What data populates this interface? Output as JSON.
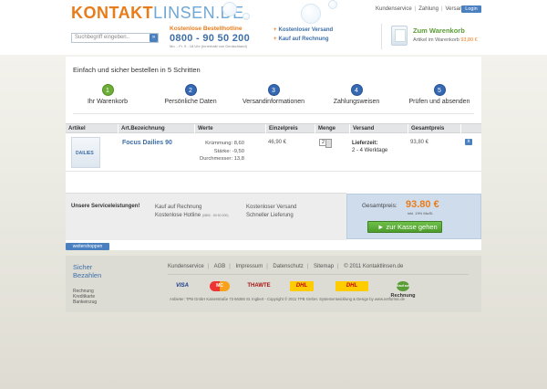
{
  "header": {
    "logo_part1": "KONTAKT",
    "logo_part2": "LINSEN.DE",
    "search_placeholder": "Suchbegriff eingeben..",
    "search_go": "»",
    "hotline_title": "Kostenlose Bestellhotline",
    "hotline_number": "0800 - 90 50 200",
    "hotline_hours": "Mo. - Fr. 9 - 18 Uhr (innerhalb von Deutschland)",
    "features": [
      "Kostenloser Versand",
      "Kauf auf Rechnung"
    ],
    "top_links": [
      "Kundenservice",
      "Zahlung",
      "Versand"
    ],
    "login": "Login",
    "cart_title": "Zum Warenkorb",
    "cart_label": "Artikel im Warenkorb",
    "cart_amount": "93,80 €"
  },
  "steps": {
    "title": "Einfach und sicher bestellen in 5 Schritten",
    "items": [
      {
        "num": "1",
        "label": "Ihr Warenkorb"
      },
      {
        "num": "2",
        "label": "Persönliche Daten"
      },
      {
        "num": "3",
        "label": "Versandinformationen"
      },
      {
        "num": "4",
        "label": "Zahlungsweisen"
      },
      {
        "num": "5",
        "label": "Prüfen und absenden"
      }
    ]
  },
  "table": {
    "headers": [
      "Artikel",
      "Art.Bezeichnung",
      "Werte",
      "Einzelpreis",
      "Menge",
      "Versand",
      "Gesamtpreis"
    ],
    "row": {
      "image_text": "DAILIES",
      "name": "Focus Dailies 90",
      "werte": [
        "Krümmung: 8,60",
        "Stärke: -9,50",
        "Durchmesser: 13,8"
      ],
      "einzelpreis": "46,90 €",
      "menge": "2",
      "versand_label": "Lieferzeit:",
      "versand_value": "2 - 4 Werktage",
      "gesamtpreis": "93,80 €",
      "delete": "x"
    }
  },
  "service": {
    "title": "Unsere Serviceleistungen!",
    "col1": [
      "Kauf auf Rechnung",
      "Kostenlose Hotline"
    ],
    "col1_small": "(0800 - 90 50 200)",
    "col2": [
      "Kostenloser Versand",
      "Schneller Lieferung"
    ]
  },
  "total": {
    "label": "Gesamtpreis:",
    "value": "93.80 €",
    "note": "inkl. 19% MwSt.",
    "checkout": "zur Kasse gehen"
  },
  "weiter": "weitershoppen",
  "footer": {
    "sicher": [
      "Sicher",
      "Bezahlen"
    ],
    "methods_text": [
      "Rechnung",
      "Kreditkarte",
      "Bankeinzug"
    ],
    "links": [
      "Kundenservice",
      "AGB",
      "Impressum",
      "Datenschutz",
      "Sitemap",
      "© 2011 Kontaktlinsen.de"
    ],
    "payments": [
      "VISA",
      "MC",
      "THAWTE",
      "DHL",
      "DHL",
      "Kauf auf",
      "Rechnung"
    ],
    "copyright": "Anbieter: TPB GmbH Kaiserstraße 73 66386 St. Ingbert - Copyright © 2011 TPB GmbH. Systementwicklung & Design by www.netformic.de"
  }
}
